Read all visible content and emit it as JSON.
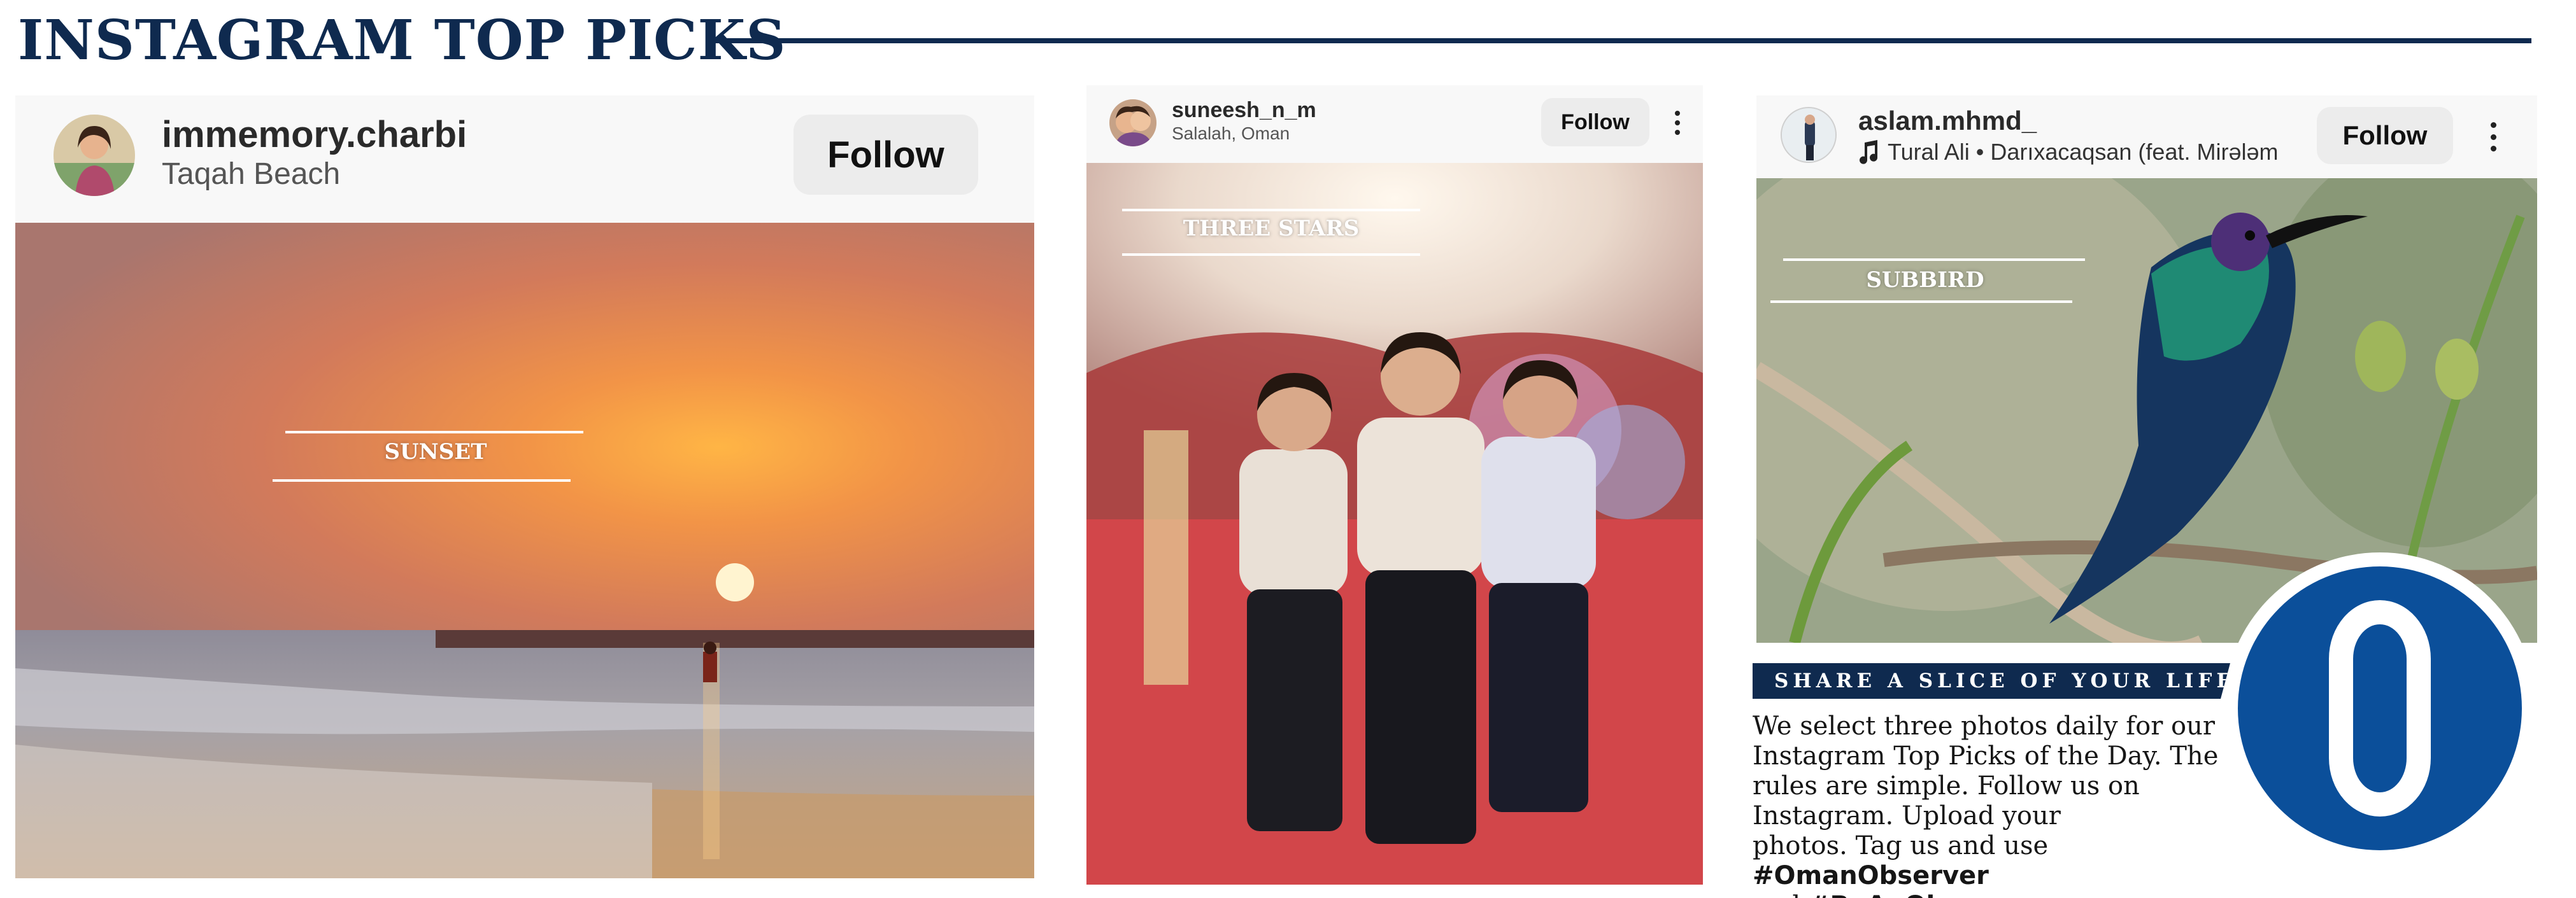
{
  "header": {
    "title": "INSTAGRAM TOP PICKS"
  },
  "posts": [
    {
      "username": "immemory.charbi",
      "location": "Taqah Beach",
      "follow_label": "Follow",
      "photo_caption": "SUNSET",
      "avatar_icon": "profile-photo-icon"
    },
    {
      "username": "suneesh_n_m",
      "location": "Salalah, Oman",
      "follow_label": "Follow",
      "photo_caption": "THREE STARS",
      "avatar_icon": "profile-photo-icon",
      "more_icon": "more-options-icon"
    },
    {
      "username": "aslam.mhmd_",
      "music_icon": "music-note-icon",
      "audio": "Tural Ali • Darıxacaqsan (feat. Mirələm",
      "follow_label": "Follow",
      "photo_caption": "SUBBIRD",
      "avatar_icon": "profile-photo-icon",
      "more_icon": "more-options-icon"
    }
  ],
  "cta": {
    "heading": "SHARE A SLICE OF YOUR LIFE",
    "body_lines": [
      "We select three photos daily for our",
      "Instagram Top Picks of the Day. The",
      "rules are simple. Follow us on",
      "Instagram. Upload your"
    ],
    "body_line5_prefix": "photos. Tag us and use ",
    "hashtag_1": "#OmanObserver",
    "body_line6_prefix": "and ",
    "hashtag_2": "#BeAnObserver."
  },
  "logo": {
    "icon": "oman-observer-logo-icon",
    "color": "#0b4f9a"
  },
  "colors": {
    "navy": "#0f2a4f",
    "brand_blue": "#0b4f9a"
  }
}
